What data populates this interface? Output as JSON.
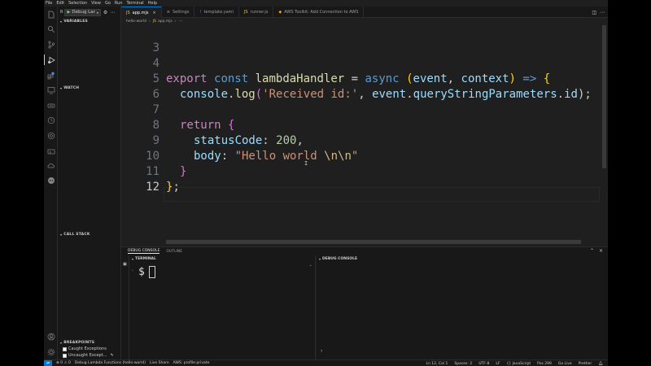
{
  "menu": [
    "File",
    "Edit",
    "Selection",
    "View",
    "Go",
    "Run",
    "Terminal",
    "Help"
  ],
  "debug_toolbar": {
    "config_label": "Debug Lar"
  },
  "sidebar": {
    "variables": "VARIABLES",
    "watch": "WATCH",
    "call_stack": "CALL STACK",
    "breakpoints": "BREAKPOINTS",
    "bp_items": [
      "Caught Exceptions",
      "Uncaught Except..."
    ]
  },
  "tabs": [
    "app.mjs",
    "Settings",
    "template.yaml",
    "runner.js",
    "AWS Toolkit: Add Connection to AWS"
  ],
  "breadcrumb": {
    "folder": "hello-world",
    "file": "app.mjs"
  },
  "editor": {
    "line_numbers": [
      "3",
      "4",
      "5",
      "6",
      "7",
      "8",
      "9",
      "10",
      "11",
      "12"
    ],
    "l4": {
      "export": "export",
      "const": "const",
      "name": "lambdaHandler",
      "eq": " = ",
      "async": "async",
      "open": "(",
      "p1": "event",
      "comma": ", ",
      "p2": "context",
      "close": ")",
      "arrow": " => ",
      "brace": "{"
    },
    "l5": {
      "obj": "console",
      "dot": ".",
      "fn": "log",
      "open": "(",
      "str": "'Received id:'",
      "comma": ", ",
      "v1": "event",
      "dot2": ".",
      "v2": "queryStringParameters",
      "dot3": ".",
      "v3": "id",
      "close": ");"
    },
    "l7": {
      "ret": "return",
      "brace": "{"
    },
    "l8": {
      "key": "statusCode",
      "colon": ": ",
      "num": "200",
      "comma": ","
    },
    "l9": {
      "key": "body",
      "colon": ": ",
      "s1": "\"Hello world ",
      "e1": "\\n\\n",
      "s2": "\""
    },
    "l10": {
      "brace": "}"
    },
    "l11": {
      "brace": "}",
      "semi": ";"
    }
  },
  "panel": {
    "tabs": [
      "DEBUG CONSOLE",
      "OUTLINE"
    ],
    "terminal_title": "TERMINAL",
    "console_title": "DEBUG CONSOLE",
    "prompt": "$",
    "console_prompt": "›"
  },
  "statusbar": {
    "left": [
      "Debug Lambda Functions (hello-world)",
      "Live Share",
      "AWS: profile:private"
    ],
    "right": [
      "Ln 12, Col 1",
      "Spaces: 2",
      "UTF-8",
      "LF",
      "{} JavaScript",
      "Pos 299",
      "Go Live",
      "Prettier"
    ]
  }
}
